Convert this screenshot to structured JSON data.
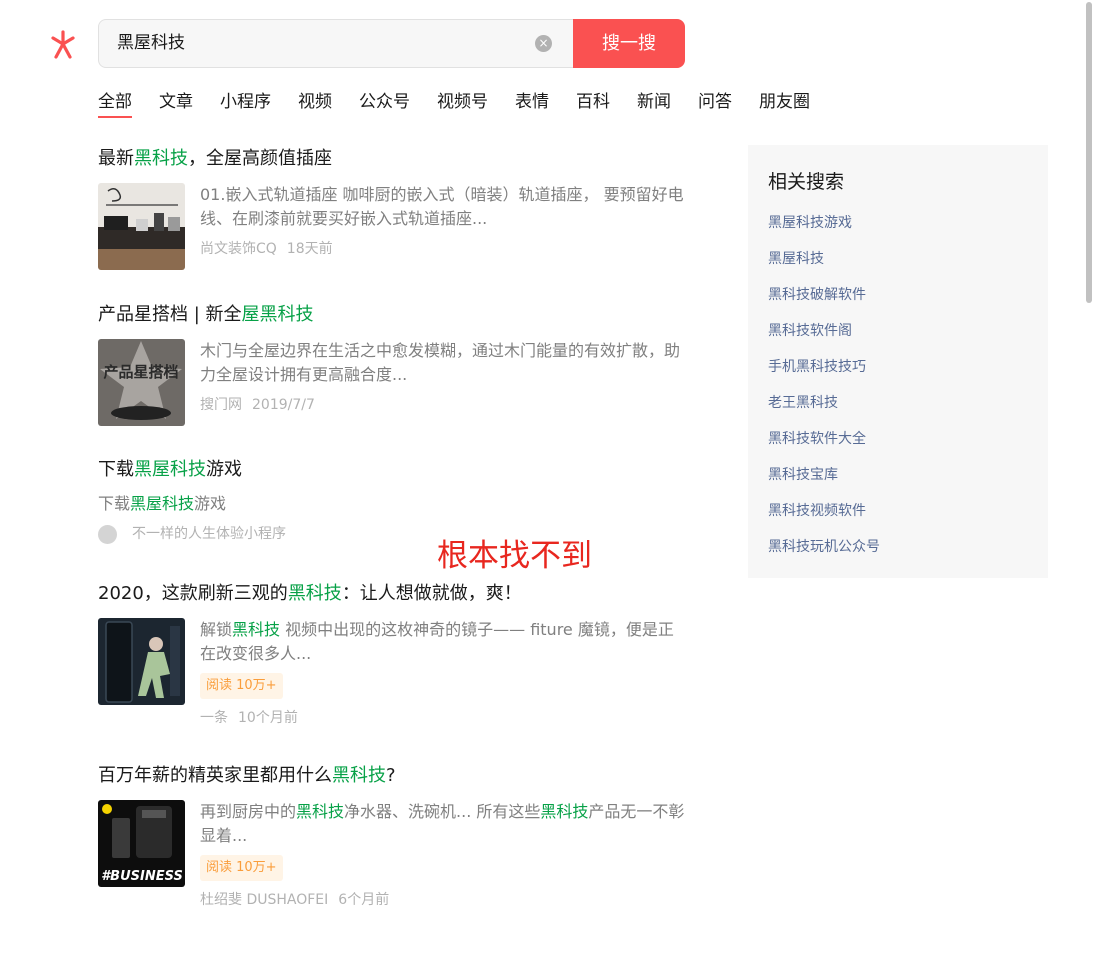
{
  "search": {
    "query": "黑屋科技",
    "button_label": "搜一搜",
    "clear_glyph": "×"
  },
  "tabs": [
    {
      "label": "全部",
      "active": true
    },
    {
      "label": "文章"
    },
    {
      "label": "小程序"
    },
    {
      "label": "视频"
    },
    {
      "label": "公众号"
    },
    {
      "label": "视频号"
    },
    {
      "label": "表情"
    },
    {
      "label": "百科"
    },
    {
      "label": "新闻"
    },
    {
      "label": "问答"
    },
    {
      "label": "朋友圈"
    }
  ],
  "results": [
    {
      "title_pre": "最新",
      "title_hl": "黑科技",
      "title_post": "，全屋高颜值插座",
      "snippet": "01.嵌入式轨道插座 咖啡厨的嵌入式（暗装）轨道插座， 要预留好电线、在刷漆前就要买好嵌入式轨道插座...",
      "source": "尚文装饰CQ",
      "time": "18天前",
      "thumb_icon": "socket-photo"
    },
    {
      "title_pre": "产品星搭档 | 新全",
      "title_hl": "屋黑科技",
      "title_post": "",
      "snippet": "木门与全屋边界在生活之中愈发模糊，通过木门能量的有效扩散，助力全屋设计拥有更高融合度...",
      "source": "搜门网",
      "time": "2019/7/7",
      "thumb_text": "产品星搭档"
    },
    {
      "title_pre": "下载",
      "title_hl": "黑屋科技",
      "title_post": "游戏",
      "snippet_pre": "下载",
      "snippet_hl": "黑屋科技",
      "snippet_post": "游戏",
      "source": "不一样的人生体验小程序"
    },
    {
      "title_pre": "2020，这款刷新三观的",
      "title_hl": "黑科技",
      "title_post": "：让人想做就做，爽！",
      "snippet_pre": "解锁",
      "snippet_hl": "黑科技",
      "snippet_post": " 视频中出现的这枚神奇的镜子—— fiture 魔镜，便是正在改变很多人...",
      "badge": "阅读 10万+",
      "source": "一条",
      "time": "10个月前",
      "thumb_icon": "fitness-mirror-photo"
    },
    {
      "title_pre": "百万年薪的精英家里都用什么",
      "title_hl": "黑科技",
      "title_post": "?",
      "snippet_pre": "再到厨房中的",
      "snippet_hl": "黑科技",
      "snippet_mid": "净水器、洗碗机... 所有这些",
      "snippet_hl2": "黑科技",
      "snippet_post": "产品无一不彰显着...",
      "badge": "阅读 10万+",
      "source": "杜绍斐 DUSHAOFEI",
      "time": "6个月前",
      "thumb_text": "#BUSINESS"
    }
  ],
  "annotation": "根本找不到",
  "sidebar": {
    "title": "相关搜索",
    "items": [
      "黑屋科技游戏",
      "黑屋科技",
      "黑科技破解软件",
      "黑科技软件阁",
      "手机黑科技技巧",
      "老王黑科技",
      "黑科技软件大全",
      "黑科技宝库",
      "黑科技视频软件",
      "黑科技玩机公众号"
    ]
  },
  "colors": {
    "accent": "#fa5151",
    "highlight": "#07a147",
    "link": "#576b95",
    "annotation": "#e8271f"
  }
}
